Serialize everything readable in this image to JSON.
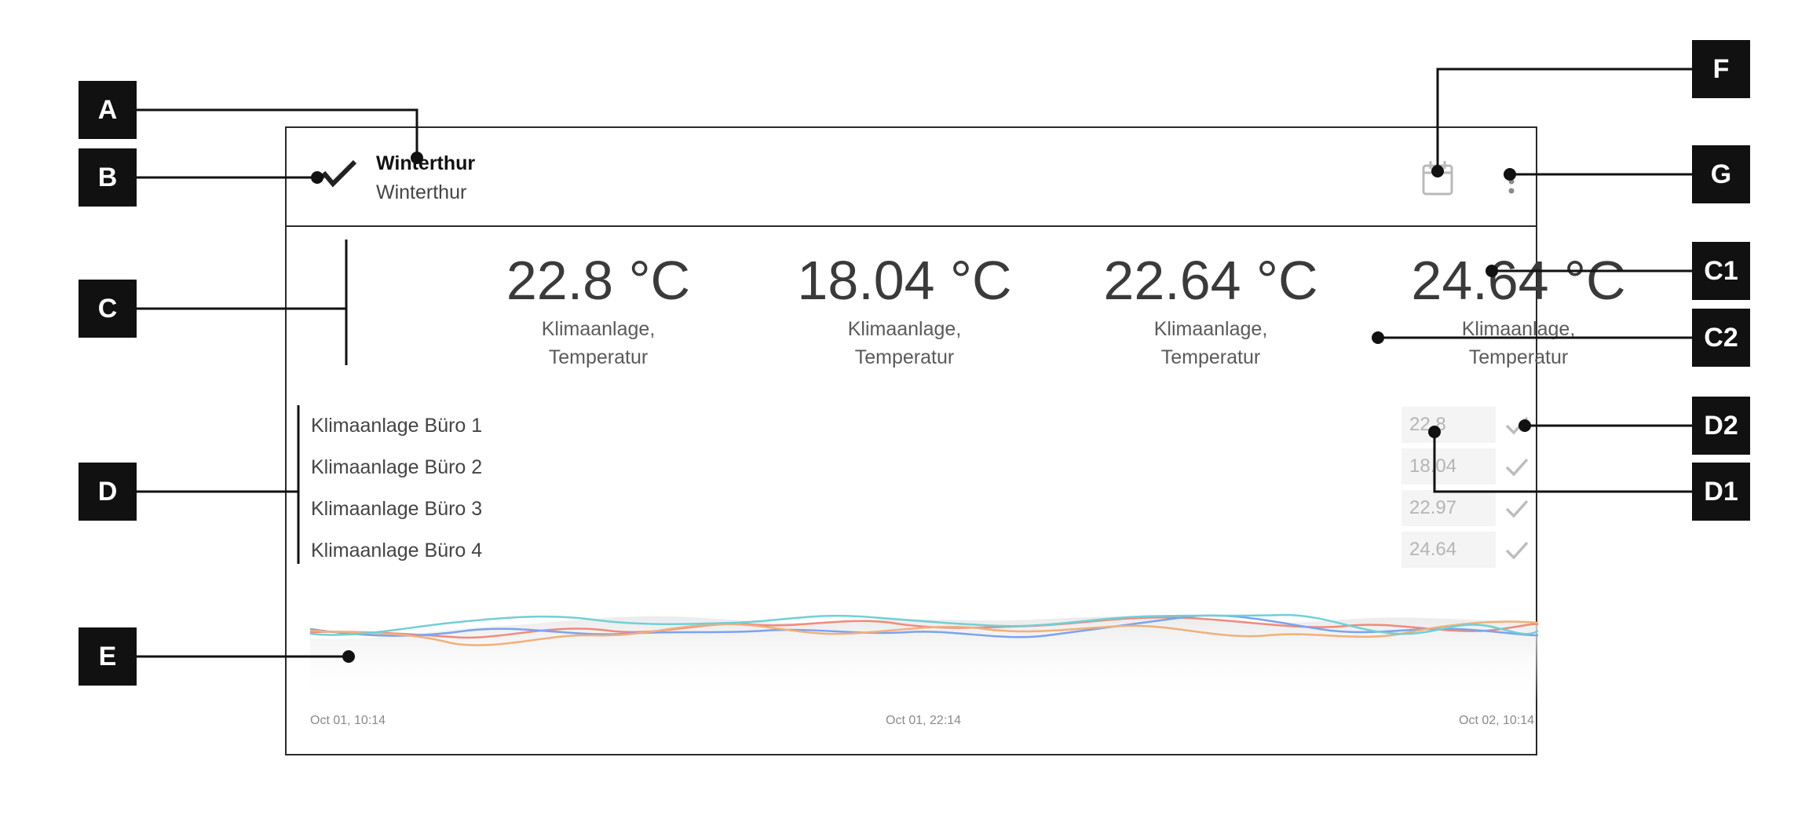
{
  "header": {
    "title": "Winterthur",
    "subtitle": "Winterthur",
    "icon": "trend-chart-icon",
    "actions": [
      {
        "name": "calendar-icon"
      },
      {
        "name": "more-vertical-icon"
      }
    ]
  },
  "stats": [
    {
      "value": "22.8 °C",
      "label_line1": "Klimaanlage,",
      "label_line2": "Temperatur"
    },
    {
      "value": "18.04 °C",
      "label_line1": "Klimaanlage,",
      "label_line2": "Temperatur"
    },
    {
      "value": "22.64 °C",
      "label_line1": "Klimaanlage,",
      "label_line2": "Temperatur"
    },
    {
      "value": "24.64 °C",
      "label_line1": "Klimaanlage,",
      "label_line2": "Temperatur"
    }
  ],
  "entities": [
    {
      "name": "Klimaanlage Büro 1",
      "value": "22.8"
    },
    {
      "name": "Klimaanlage Büro 2",
      "value": "18.04"
    },
    {
      "name": "Klimaanlage Büro 3",
      "value": "22.97"
    },
    {
      "name": "Klimaanlage Büro 4",
      "value": "24.64"
    }
  ],
  "chart": {
    "x_labels": [
      "Oct 01, 10:14",
      "Oct 01, 22:14",
      "Oct 02, 10:14"
    ],
    "series_colors": [
      "#f08a7a",
      "#7aa3f0",
      "#f0b07a",
      "#6fd0d6"
    ]
  },
  "annotations": [
    "A",
    "B",
    "C",
    "C1",
    "C2",
    "D",
    "D1",
    "D2",
    "E",
    "F",
    "G"
  ],
  "colors": {
    "annotation_box": "#111111",
    "border": "#2a2a2a",
    "muted_text": "#b5b5b5"
  }
}
